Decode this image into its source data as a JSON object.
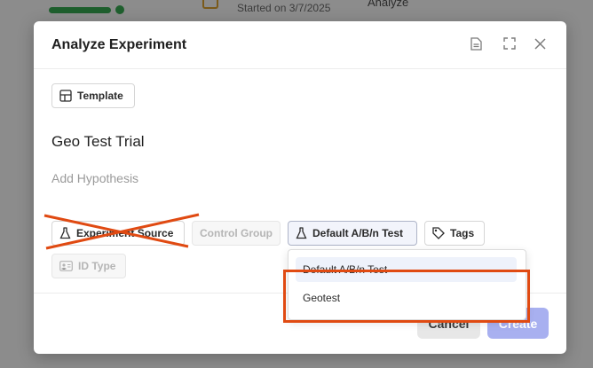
{
  "background": {
    "started_text": "Started on 3/7/2025",
    "analyze_text": "Analyze"
  },
  "modal": {
    "title": "Analyze Experiment",
    "template_label": "Template",
    "experiment_title": "Geo Test Trial",
    "hypothesis_placeholder": "Add Hypothesis",
    "chips": {
      "experiment_source": "Experiment Source",
      "control_group": "Control Group",
      "test_type": "Default A/B/n Test",
      "tags": "Tags",
      "id_type": "ID Type"
    },
    "dropdown": {
      "options": [
        "Default A/B/n Test",
        "Geotest"
      ]
    },
    "cancel_label": "Cancel",
    "create_label": "Create"
  },
  "colors": {
    "annotation": "#e04a12",
    "create_button": "#a8b0f0"
  }
}
